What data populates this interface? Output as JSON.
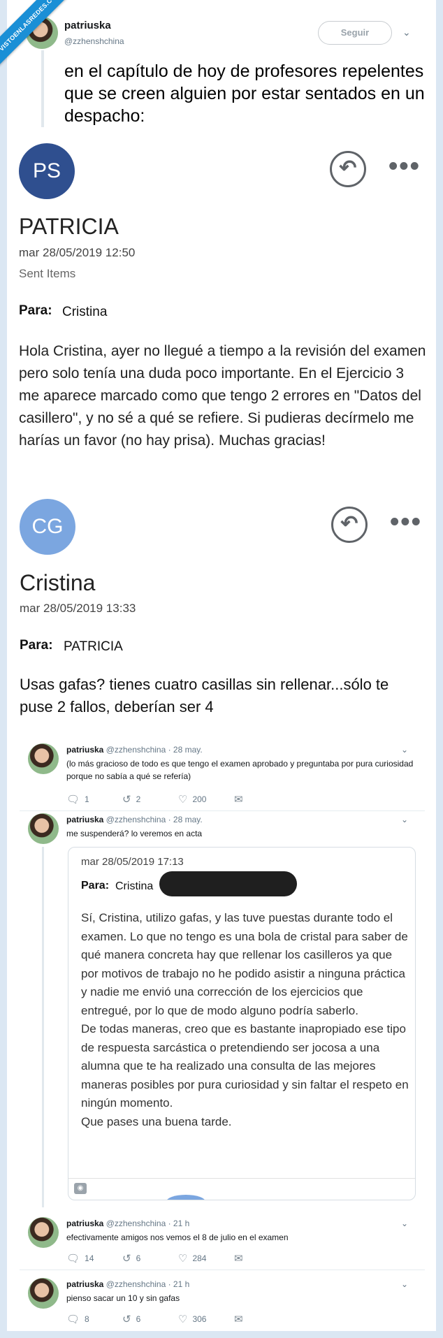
{
  "watermark": "VISTOENLASREDES.COM",
  "top_tweet": {
    "name": "patriuska",
    "handle": "@zzhenshchina",
    "follow_label": "Seguir",
    "text": "en el capítulo de hoy de profesores repelentes que se creen alguien por estar sentados en un despacho:"
  },
  "email1": {
    "initials": "PS",
    "avatar_color": "#2f4f8f",
    "sender": "PATRICIA",
    "date": "mar 28/05/2019 12:50",
    "folder": "Sent Items",
    "to_label": "Para:",
    "to_value": "Cristina",
    "body": "Hola Cristina, ayer no llegué a tiempo a la revisión del examen pero solo tenía una duda poco importante. En el Ejercicio 3 me aparece marcado como que tengo 2 errores en \"Datos del casillero\", y no sé a qué se refiere. Si pudieras decírmelo me harías un favor (no hay prisa). Muchas gracias!"
  },
  "email2": {
    "initials": "CG",
    "avatar_color": "#7ba6e0",
    "sender": "Cristina",
    "date": "mar 28/05/2019 13:33",
    "to_label": "Para:",
    "to_value": "PATRICIA",
    "body": "Usas gafas? tienes cuatro casillas sin rellenar...sólo te puse 2 fallos, deberían ser 4"
  },
  "replies": [
    {
      "name": "patriuska",
      "meta": "@zzhenshchina · 28 may.",
      "text": "(lo más gracioso de todo es que tengo el examen aprobado y preguntaba por pura curiosidad porque no sabía a qué se refería)",
      "replies": "1",
      "retweets": "2",
      "likes": "200"
    },
    {
      "name": "patriuska",
      "meta": "@zzhenshchina · 28 may.",
      "text": "me suspenderá? lo veremos en acta"
    },
    {
      "name": "patriuska",
      "meta": "@zzhenshchina · 21 h",
      "text": "efectivamente amigos nos vemos el 8 de julio en el examen",
      "replies": "14",
      "retweets": "6",
      "likes": "284"
    },
    {
      "name": "patriuska",
      "meta": "@zzhenshchina · 21 h",
      "text": "pienso sacar un 10 y sin gafas",
      "replies": "8",
      "retweets": "6",
      "likes": "306"
    }
  ],
  "embedded_email": {
    "date": "mar 28/05/2019 17:13",
    "to_label": "Para:",
    "to_value": "Cristina",
    "body": "Sí, Cristina, utilizo gafas, y las tuve puestas durante todo el examen. Lo que no tengo es una bola de cristal para saber de qué manera concreta hay que rellenar los casilleros ya que por motivos de trabajo no he podido asistir a ninguna práctica y nadie me envió una corrección de los ejercicios que entregué, por lo que de modo alguno podría saberlo.\nDe todas maneras, creo que es bastante inapropiado ese tipo de respuesta sarcástica o pretendiendo ser jocosa a una alumna que te ha realizado una consulta de las mejores maneras posibles por pura curiosidad y sin faltar el respeto en ningún momento.\nQue pases una buena tarde."
  },
  "icons": {
    "reply": "reply-icon",
    "retweet": "retweet-icon",
    "like": "heart-icon",
    "dm": "envelope-icon",
    "more": "more-dots-icon",
    "chevron": "chevron-down-icon"
  }
}
